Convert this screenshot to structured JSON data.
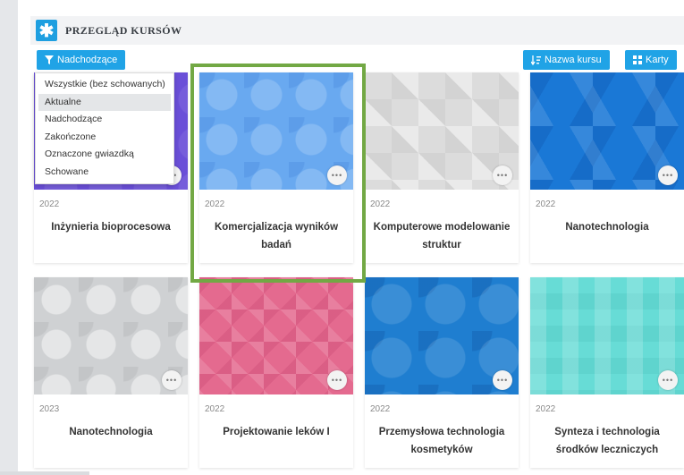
{
  "header": {
    "logo_glyph": "✱",
    "title": "PRZEGLĄD KURSÓW"
  },
  "toolbar": {
    "filter_label": "Nadchodzące",
    "sort_label": "Nazwa kursu",
    "view_label": "Karty"
  },
  "filter_menu": {
    "items": [
      "Wszystkie (bez schowanych)",
      "Aktualne",
      "Nadchodzące",
      "Zakończone",
      "Oznaczone gwiazdką",
      "Schowane"
    ],
    "active_item": "Aktualne"
  },
  "courses": [
    {
      "year": "2022",
      "name": "Inżynieria bioprocesowa",
      "pattern": "purple"
    },
    {
      "year": "2022",
      "name": "Komercjalizacja wyników badań",
      "pattern": "light-blue"
    },
    {
      "year": "2022",
      "name": "Komputerowe modelowanie struktur",
      "pattern": "grey"
    },
    {
      "year": "2022",
      "name": "Nanotechnologia",
      "pattern": "blue"
    },
    {
      "year": "2023",
      "name": "Nanotechnologia",
      "pattern": "grey"
    },
    {
      "year": "2022",
      "name": "Projektowanie leków I",
      "pattern": "pink"
    },
    {
      "year": "2022",
      "name": "Przemysłowa technologia kosmetyków",
      "pattern": "blue"
    },
    {
      "year": "2022",
      "name": "Synteza i technologia środków leczniczych",
      "pattern": "teal"
    }
  ],
  "card_menu_glyph": "•••",
  "colors": {
    "accent": "#20a3e6",
    "highlight": "#72a844"
  }
}
